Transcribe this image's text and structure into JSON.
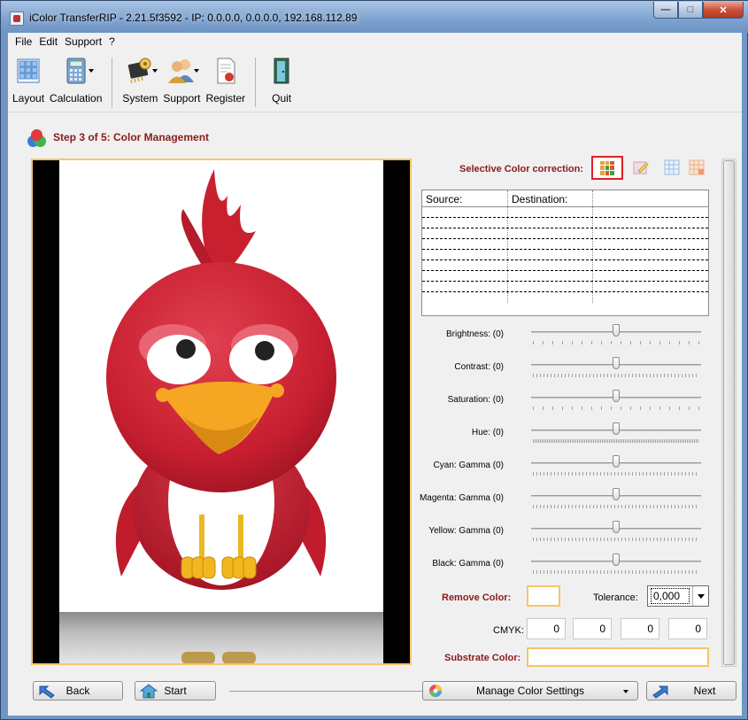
{
  "window": {
    "title": "iColor TransferRIP - 2.21.5f3592 - IP: 0.0.0.0, 0.0.0.0, 192.168.112.89",
    "min_symbol": "—",
    "max_symbol": "□",
    "close_symbol": "✕"
  },
  "menu": [
    "File",
    "Edit",
    "Support",
    "?"
  ],
  "toolbar": {
    "layout": "Layout",
    "calculation": "Calculation",
    "system": "System",
    "support": "Support",
    "register": "Register",
    "quit": "Quit"
  },
  "step": {
    "title": "Step 3 of 5: Color Management"
  },
  "selective": {
    "label": "Selective Color correction:"
  },
  "table": {
    "headers": [
      "Source:",
      "Destination:",
      ""
    ],
    "rows": [
      [
        "",
        "",
        ""
      ],
      [
        "",
        "",
        ""
      ],
      [
        "",
        "",
        ""
      ],
      [
        "",
        "",
        ""
      ],
      [
        "",
        "",
        ""
      ],
      [
        "",
        "",
        ""
      ],
      [
        "",
        "",
        ""
      ],
      [
        "",
        "",
        ""
      ]
    ]
  },
  "sliders": [
    {
      "label": "Brightness: (0)",
      "value": 0
    },
    {
      "label": "Contrast: (0)",
      "value": 0
    },
    {
      "label": "Saturation: (0)",
      "value": 0
    },
    {
      "label": "Hue: (0)",
      "value": 0
    },
    {
      "label": "Cyan: Gamma  (0)",
      "value": 0
    },
    {
      "label": "Magenta: Gamma  (0)",
      "value": 0
    },
    {
      "label": "Yellow: Gamma  (0)",
      "value": 0
    },
    {
      "label": "Black: Gamma  (0)",
      "value": 0
    }
  ],
  "remove_color": {
    "label": "Remove Color:"
  },
  "tolerance": {
    "label": "Tolerance:",
    "value": "0,000"
  },
  "cmyk": {
    "label": "CMYK:",
    "values": [
      "0",
      "0",
      "0",
      "0"
    ]
  },
  "substrate": {
    "label": "Substrate Color:"
  },
  "buttons": {
    "back": "Back",
    "start": "Start",
    "manage": "Manage Color Settings",
    "next": "Next"
  },
  "colors": {
    "accent_red": "#8b1a1a",
    "highlight_border": "#f4c56a",
    "bird_red": "#c8202f",
    "beak": "#f5a623"
  }
}
